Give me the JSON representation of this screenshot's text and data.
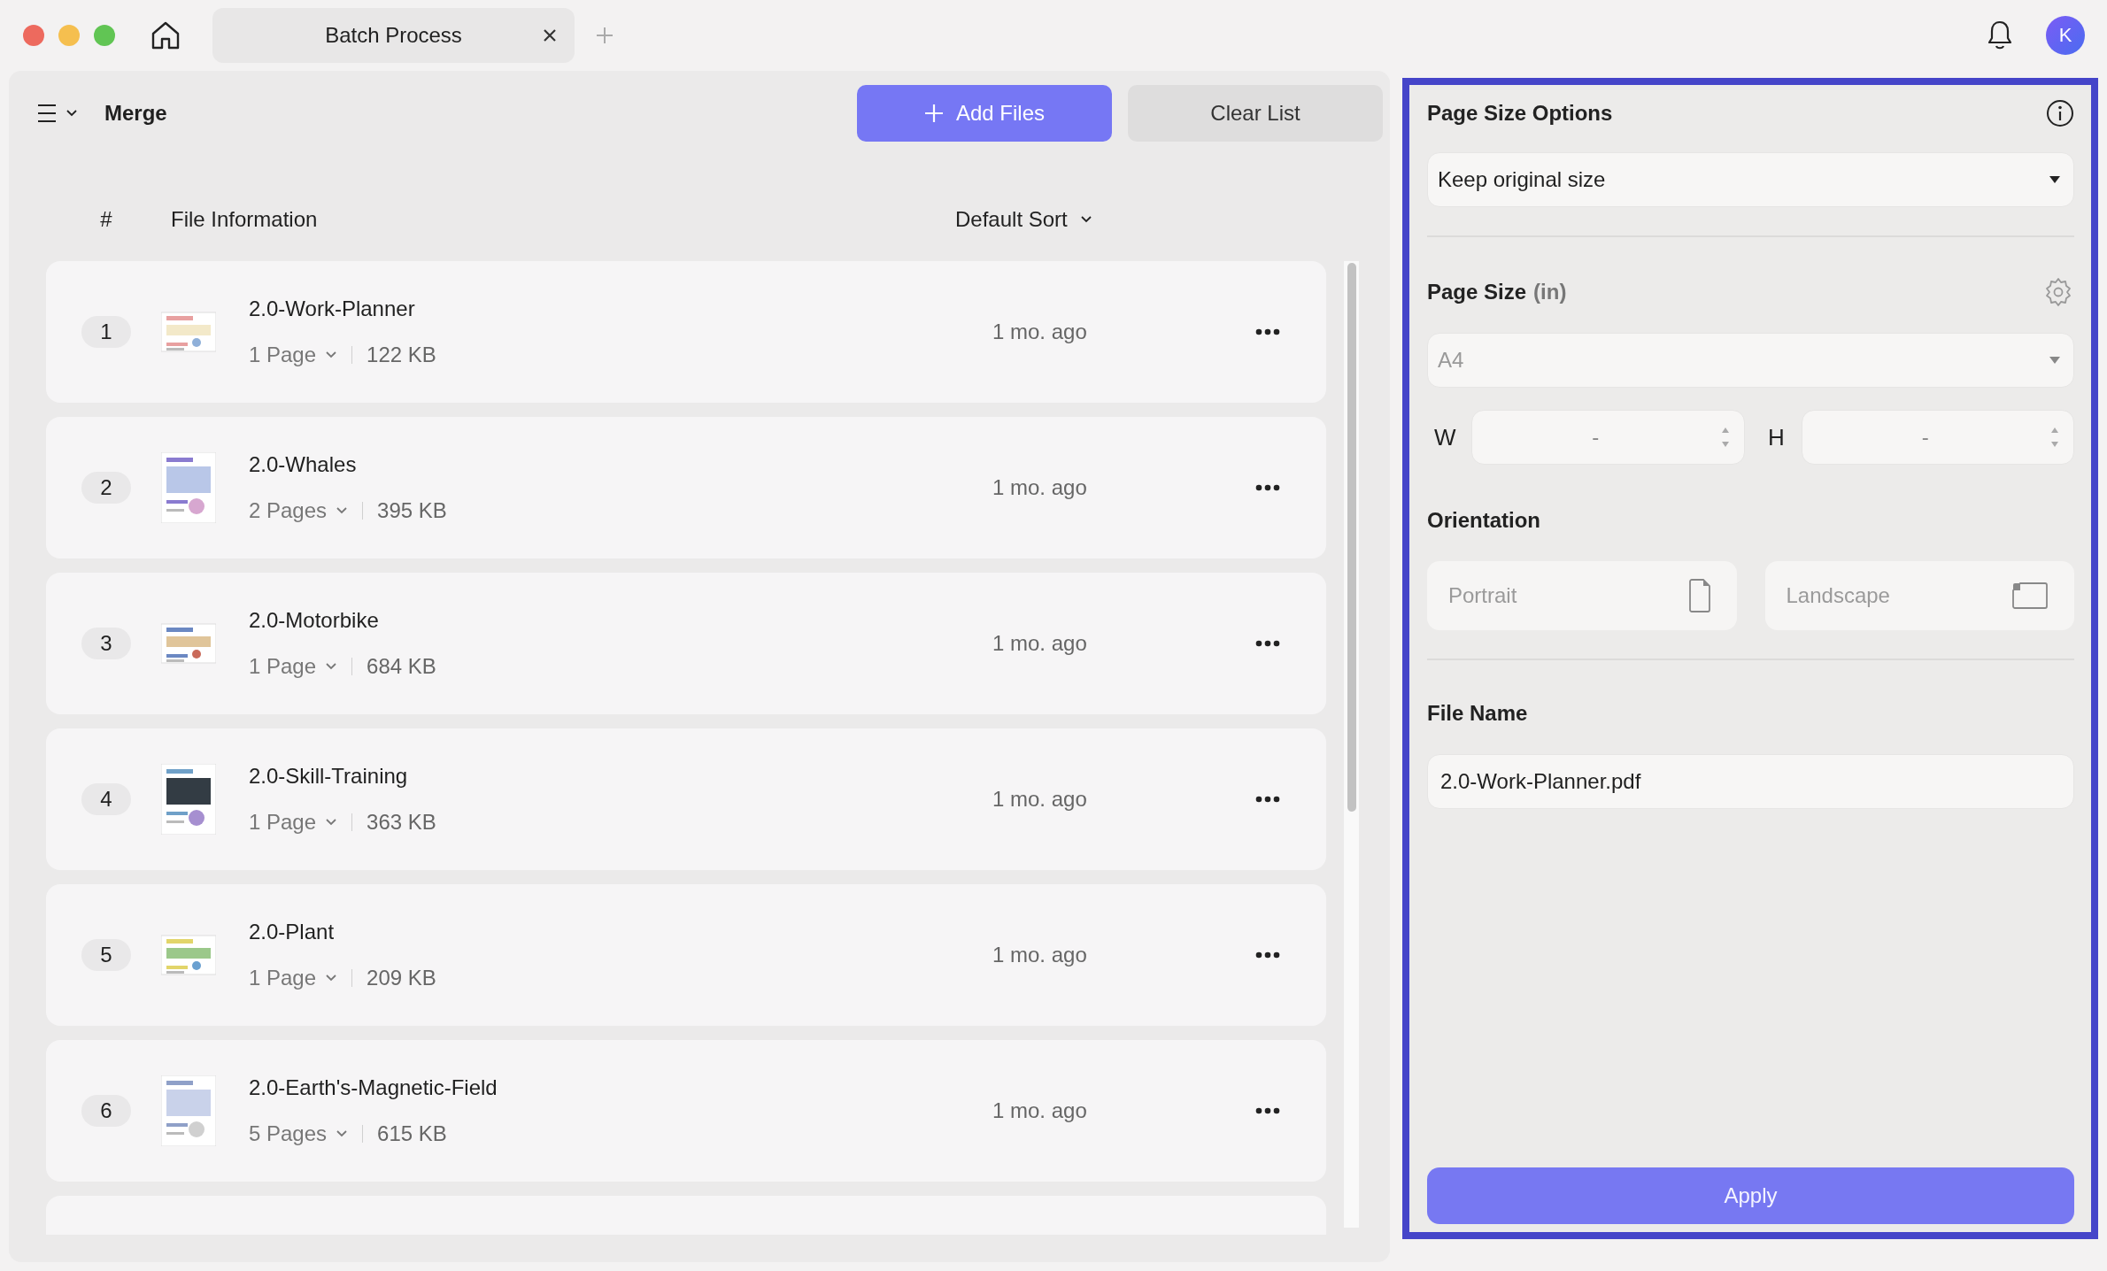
{
  "titlebar": {
    "tab": {
      "title": "Batch Process"
    },
    "avatar": "K"
  },
  "toolbar": {
    "title": "Merge",
    "buttons": [
      {
        "kind": "primary",
        "label": "Add Files"
      },
      {
        "kind": "secondary",
        "label": "Clear List"
      }
    ]
  },
  "list": {
    "columns": [
      "#",
      "File Information"
    ],
    "sort": "Default Sort",
    "rows": [
      {
        "index": "1",
        "name": "2.0-Work-Planner",
        "pages": "1 Page",
        "size": "122 KB",
        "modified": "1 mo. ago"
      },
      {
        "index": "2",
        "name": "2.0-Whales",
        "pages": "2 Pages",
        "size": "395 KB",
        "modified": "1 mo. ago"
      },
      {
        "index": "3",
        "name": "2.0-Motorbike",
        "pages": "1 Page",
        "size": "684 KB",
        "modified": "1 mo. ago"
      },
      {
        "index": "4",
        "name": "2.0-Skill-Training",
        "pages": "1 Page",
        "size": "363 KB",
        "modified": "1 mo. ago"
      },
      {
        "index": "5",
        "name": "2.0-Plant",
        "pages": "1 Page",
        "size": "209 KB",
        "modified": "1 mo. ago"
      },
      {
        "index": "6",
        "name": "2.0-Earth's-Magnetic-Field",
        "pages": "5 Pages",
        "size": "615 KB",
        "modified": "1 mo. ago"
      }
    ]
  },
  "panel": {
    "title": "Page Size Options",
    "size_option": {
      "value": "Keep original size",
      "disabled": false
    },
    "page_size": {
      "label": "Page Size",
      "unit": "(in)",
      "preset": {
        "value": "A4",
        "disabled": true
      },
      "width": {
        "label": "W",
        "value": "-",
        "disabled": true
      },
      "height": {
        "label": "H",
        "value": "-",
        "disabled": true
      }
    },
    "orientation": {
      "label": "Orientation",
      "options": [
        {
          "label": "Portrait",
          "kind": "portrait",
          "selected": false,
          "disabled": true
        },
        {
          "label": "Landscape",
          "kind": "landscape",
          "selected": false,
          "disabled": true
        }
      ]
    },
    "file_name": {
      "label": "File Name",
      "value": "2.0-Work-Planner.pdf"
    },
    "apply": {
      "label": "Apply"
    }
  }
}
